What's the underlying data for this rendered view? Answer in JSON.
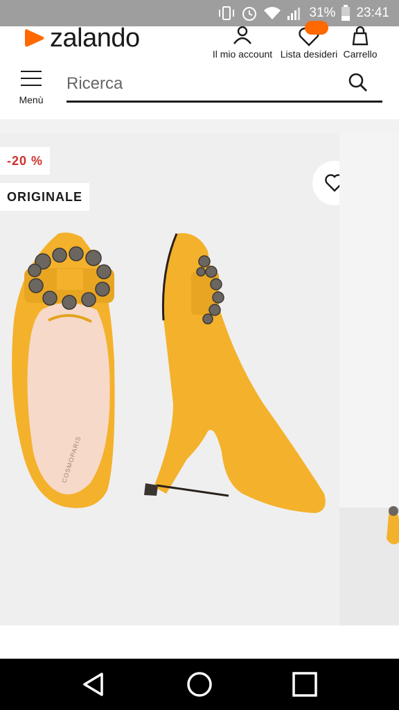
{
  "status_bar": {
    "battery": "31%",
    "time": "23:41",
    "icons": [
      "vibrate-icon",
      "alarm-icon",
      "wifi-icon",
      "signal-icon",
      "battery-icon"
    ]
  },
  "header": {
    "logo_text": "zalando",
    "account_label": "Il mio account",
    "wishlist_label": "Lista desideri",
    "cart_label": "Carrello",
    "brand_color": "#ff6900"
  },
  "search": {
    "menu_label": "Menù",
    "placeholder": "Ricerca"
  },
  "product": {
    "discount_badge": "-20 %",
    "original_badge": "ORIGINALE",
    "brand_stamp": "COSMOPARIS",
    "shoe_color": "#f4b12b",
    "sale_color": "#d0312d"
  },
  "nav": {
    "buttons": [
      "back-icon",
      "home-icon",
      "recents-icon"
    ]
  }
}
